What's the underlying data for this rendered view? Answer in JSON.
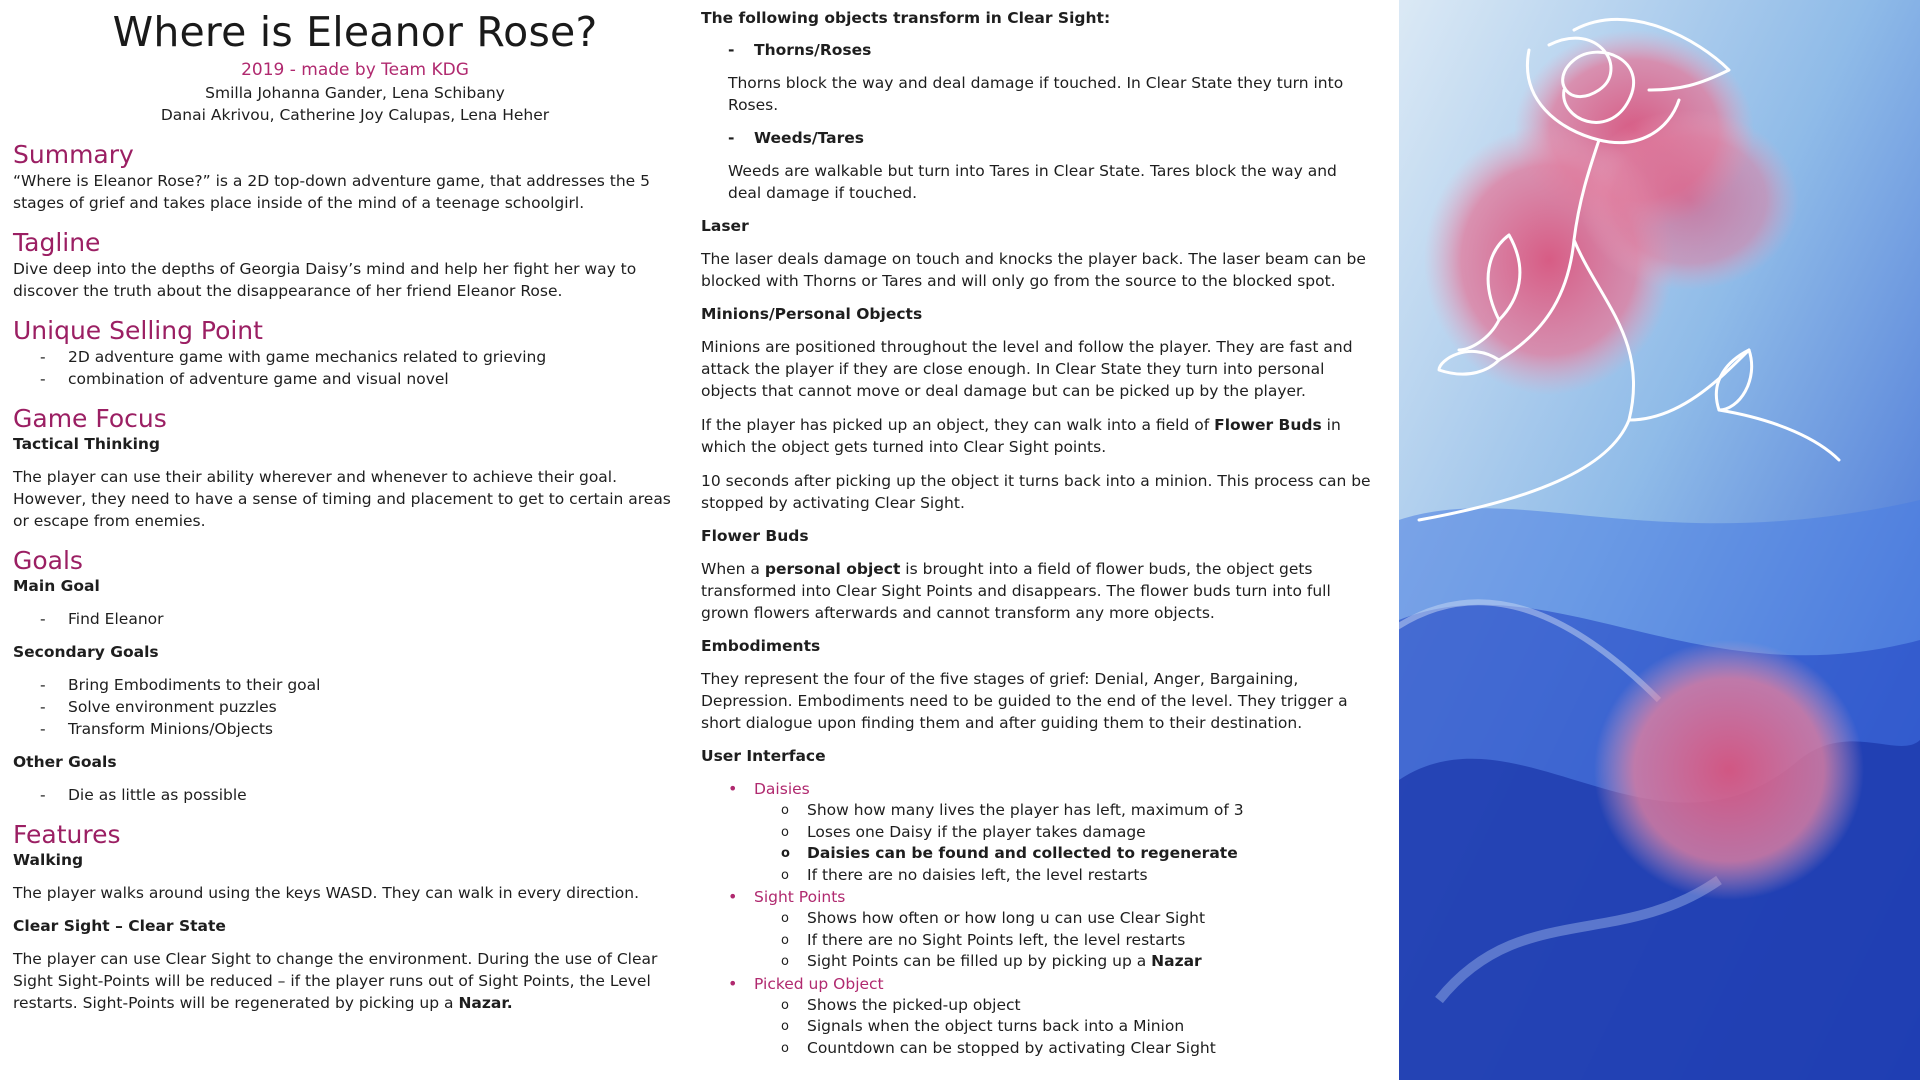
{
  "title": "Where is Eleanor Rose?",
  "subtitle": "2019 - made by Team KDG",
  "authors": [
    "Smilla Johanna Gander, Lena Schibany",
    "Danai Akrivou, Catherine Joy Calupas, Lena Heher"
  ],
  "summary": {
    "heading": "Summary",
    "text": "“Where is Eleanor Rose?” is a 2D top-down adventure game, that addresses the 5 stages of grief and takes place inside of the mind of a teenage schoolgirl."
  },
  "tagline": {
    "heading": "Tagline",
    "text": "Dive deep into the depths of Georgia Daisy’s mind and help her fight her way to discover the truth about the disappearance of her friend Eleanor Rose."
  },
  "usp": {
    "heading": "Unique Selling Point",
    "items": [
      "2D adventure game with game mechanics related to grieving",
      "combination of adventure game and visual novel"
    ]
  },
  "focus": {
    "heading": "Game Focus",
    "subheading": "Tactical Thinking",
    "text": "The player can use their ability wherever and whenever to achieve their goal. However, they need to have a sense of timing and placement to get to certain areas or escape from enemies."
  },
  "goals": {
    "heading": "Goals",
    "main_label": "Main Goal",
    "main_items": [
      "Find Eleanor"
    ],
    "secondary_label": "Secondary Goals",
    "secondary_items": [
      "Bring Embodiments to their goal",
      "Solve environment puzzles",
      "Transform Minions/Objects"
    ],
    "other_label": "Other Goals",
    "other_items": [
      "Die as little as possible"
    ]
  },
  "features": {
    "heading": "Features",
    "walking_label": "Walking",
    "walking_text": "The player walks around using the keys WASD. They can walk in every direction.",
    "clear_label": "Clear Sight – Clear State",
    "clear_text": "The player can use Clear Sight to change the environment. During the use of Clear Sight Sight-Points will be reduced – if the player runs out of Sight Points, the Level restarts. Sight-Points will be regenerated by picking up a ",
    "clear_bold": "Nazar."
  },
  "mid": {
    "transform_heading": "The following objects transform in Clear Sight:",
    "thorns_label": "Thorns/Roses",
    "thorns_text": "Thorns block the way and deal damage if touched. In Clear State they turn into Roses.",
    "weeds_label": "Weeds/Tares",
    "weeds_text": "Weeds are walkable but turn into Tares in Clear State. Tares block the way and deal damage if touched.",
    "laser_label": "Laser",
    "laser_text": "The laser deals damage on touch and knocks the player back. The laser beam can be blocked with Thorns or Tares and will only go from the source to the blocked spot.",
    "minions_label": "Minions/Personal Objects",
    "minions_text": "Minions are positioned throughout the level and follow the player. They are fast and attack the player if they are close enough. In Clear State they turn into personal objects that cannot move or deal damage but can be picked up by the player.",
    "pickup_text_a": "If the player has picked up an object, they can walk into a field of ",
    "pickup_bold": "Flower Buds",
    "pickup_text_b": " in which the object gets turned into Clear Sight points.",
    "seconds_text": "10 seconds after picking up the object it turns back into a minion. This process can be stopped by activating Clear Sight.",
    "buds_label": "Flower Buds",
    "buds_text_a": "When a ",
    "buds_bold": "personal object",
    "buds_text_b": " is brought into a field of flower buds, the object gets transformed into Clear Sight Points and disappears. The flower buds turn into full grown flowers afterwards and cannot transform any more objects.",
    "embod_label": "Embodiments",
    "embod_text": "They represent the four of the five stages of grief: Denial, Anger, Bargaining, Depression. Embodiments need to be guided to the end of the level. They trigger a short dialogue upon finding them and after guiding them to their destination.",
    "ui_label": "User Interface",
    "daisies": "Daisies",
    "daisies_items": [
      "Show how many lives the player has left, maximum of 3",
      "Loses one Daisy if the player takes damage",
      "Daisies can be found and collected to regenerate",
      "If there are no daisies left, the level restarts"
    ],
    "sight": "Sight Points",
    "sight_items": [
      "Shows how often or how long u can use Clear Sight",
      "If there are no Sight Points left, the level restarts",
      "Sight Points can be filled up by picking up a "
    ],
    "sight_bold": "Nazar",
    "picked": "Picked up Object",
    "picked_items": [
      "Shows the picked-up object",
      "Signals when the object turns back into a Minion",
      "Countdown can be stopped by activating Clear Sight"
    ]
  },
  "colors": {
    "accent": "#9b1f63",
    "pink": "#b0296f",
    "blue": "#2d5fd6"
  }
}
